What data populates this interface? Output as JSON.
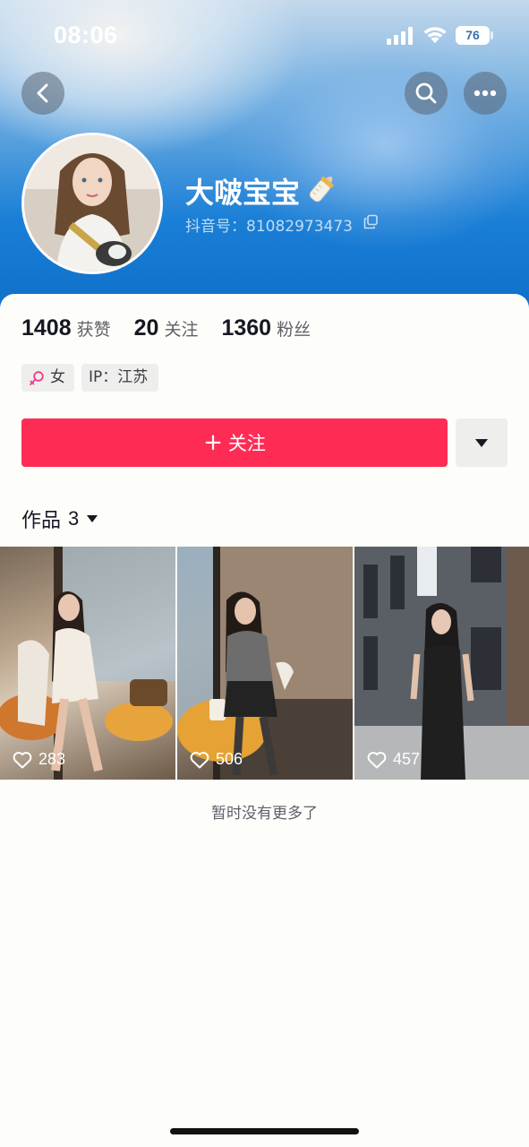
{
  "status_bar": {
    "time": "08:06",
    "battery": "76"
  },
  "profile": {
    "username": "大啵宝宝",
    "username_emoji": "baby-bottle",
    "douyin_id": "抖音号：81082973473"
  },
  "stats": [
    {
      "value": "1408",
      "label": "获赞"
    },
    {
      "value": "20",
      "label": "关注"
    },
    {
      "value": "1360",
      "label": "粉丝"
    }
  ],
  "tags": {
    "gender": "女",
    "ip": "IP：江苏"
  },
  "actions": {
    "follow_plus": "+",
    "follow_label": "关注"
  },
  "works": {
    "title": "作品",
    "count": "3",
    "items": [
      {
        "likes": "283"
      },
      {
        "likes": "506"
      },
      {
        "likes": "457"
      }
    ]
  },
  "footer": {
    "no_more": "暂时没有更多了"
  },
  "colors": {
    "accent": "#fe2c55",
    "header_blue": "#1a7fd6",
    "female_pink": "#f0398f"
  }
}
